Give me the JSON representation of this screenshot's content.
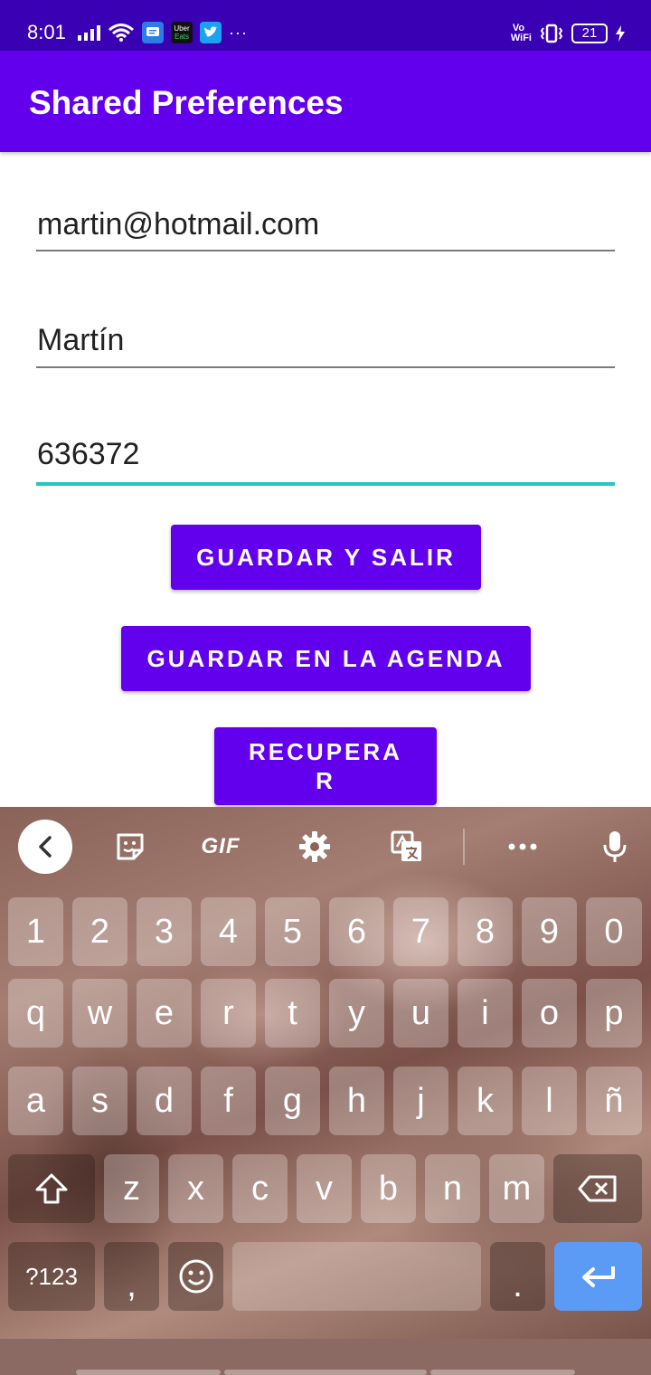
{
  "status_bar": {
    "time": "8:01",
    "notif_icon_uber_line1": "Uber",
    "notif_icon_uber_line2": "Eats",
    "overflow": "···",
    "vo": "Vo",
    "wifi": "WiFi",
    "battery_level": "21"
  },
  "app_bar": {
    "title": "Shared Preferences",
    "color": "#6200ee"
  },
  "form": {
    "email_value": "martin@hotmail.com",
    "name_value": "Martín",
    "phone_value": "636372",
    "focused_field": "phone",
    "accent_color": "#26c6c0"
  },
  "buttons": {
    "save_exit": "GUARDAR Y SALIR",
    "save_agenda": "GUARDAR EN LA AGENDA",
    "recover_line1": "RECUPERA",
    "recover_line2": "R"
  },
  "keyboard": {
    "toolbar": [
      "back-icon",
      "sticker-icon",
      "GIF",
      "gear-icon",
      "translate-icon",
      "more-icon",
      "mic-icon"
    ],
    "gif_label": "GIF",
    "row_numbers": [
      "1",
      "2",
      "3",
      "4",
      "5",
      "6",
      "7",
      "8",
      "9",
      "0"
    ],
    "row_1": [
      "q",
      "w",
      "e",
      "r",
      "t",
      "y",
      "u",
      "i",
      "o",
      "p"
    ],
    "row_2": [
      "a",
      "s",
      "d",
      "f",
      "g",
      "h",
      "j",
      "k",
      "l",
      "ñ"
    ],
    "row_3": [
      "z",
      "x",
      "c",
      "v",
      "b",
      "n",
      "m"
    ],
    "symbols_label": "?123",
    "comma": ",",
    "period": ".",
    "enter_color": "#5b9af5"
  }
}
